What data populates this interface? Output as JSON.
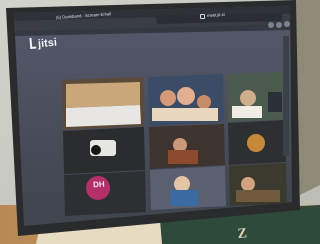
{
  "browser": {
    "tab_title": "(5) Dansband - Scream Email",
    "url": "meet.jit.si"
  },
  "app": {
    "brand": "jitsi"
  },
  "tiles": [
    {
      "name": "tile-room-view"
    },
    {
      "name": "tile-group-kids"
    },
    {
      "name": "tile-participant-3"
    },
    {
      "name": "tile-camera-off"
    },
    {
      "name": "tile-participant-5"
    },
    {
      "name": "tile-avatar-gold"
    },
    {
      "name": "tile-initials-dh",
      "initials": "DH"
    },
    {
      "name": "tile-participant-8"
    },
    {
      "name": "tile-participant-9"
    }
  ],
  "colors": {
    "background_wall": "#c7c9bf",
    "tablet_bezel": "#2a2b2c",
    "jitsi_bg": "#4b5058",
    "avatar_pink": "#b4306b",
    "avatar_gold": "#c48a3a",
    "book_cover": "#2e4a3a"
  },
  "icons": [
    "lock-icon",
    "jitsi-logo-icon",
    "video-icon",
    "settings-icon",
    "share-icon"
  ]
}
